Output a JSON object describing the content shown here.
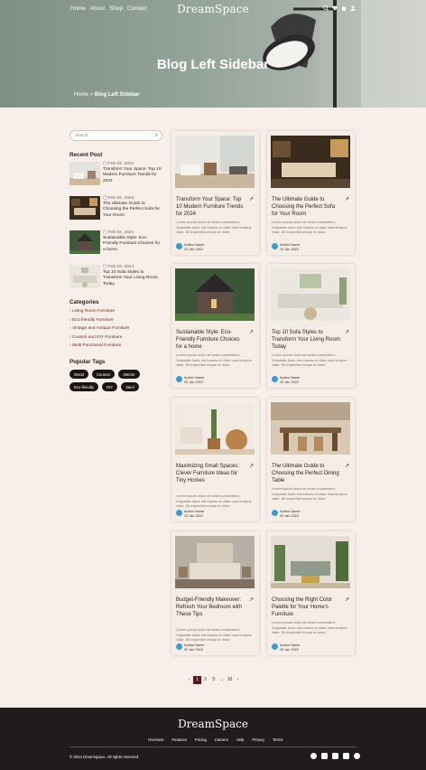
{
  "header": {
    "nav": [
      "Home",
      "About",
      "Shop",
      "Contact"
    ],
    "logo": "DreamSpace",
    "title": "Blog Left Sidebar",
    "crumb_home": "Home",
    "crumb_sep": ">",
    "crumb_current": "Blog Left Sidebar",
    "icons": [
      "search-icon",
      "heart-icon",
      "bag-icon",
      "user-icon"
    ]
  },
  "sidebar": {
    "search_placeholder": "Search",
    "recent_heading": "Recent Post",
    "recent": [
      {
        "date": "Feb 02, 2024",
        "title": "Transform Your Space: Top 10 Modern Furniture Trends for 2024"
      },
      {
        "date": "Feb 02, 2024",
        "title": "The Ultimate Guide to Choosing the Perfect Sofa for Your Room"
      },
      {
        "date": "Feb 02, 2024",
        "title": "Sustainable Style: Eco-Friendly Furniture Choices for a home"
      },
      {
        "date": "Feb 02, 2024",
        "title": "Top 10 Sofa Styles to Transform Your Living Room Today"
      }
    ],
    "categories_heading": "Categories",
    "categories": [
      "Living Room Furniture",
      "Eco-friendly Furniture",
      "Vintage and Antique Furniture",
      "Custom and DIY Furniture",
      "Multi-Functional Furniture"
    ],
    "tags_heading": "Popular Tags",
    "tags": [
      "Wood",
      "Ceramic",
      "Interior",
      "Eco-friendly",
      "DIY",
      "Steel"
    ]
  },
  "excerpt": "Lorem ipsum dolor sit amet consectetur. Vulputate dolor est mauris et vitae uma tempus vitae. Sit imperdiet neque in dolor.",
  "author_name": "Author Name",
  "author_date": "20 Jan 2022",
  "posts": [
    {
      "title": "Transform Your Space: Top 10 Modern Furniture Trends for 2024"
    },
    {
      "title": "The Ultimate Guide to Choosing the Perfect Sofa for Your Room"
    },
    {
      "title": "Sustainable Style: Eco-Friendly Furniture Choices for a home"
    },
    {
      "title": "Top 10 Sofa Styles to Transform Your Living Room Today"
    },
    {
      "title": "Maximizing Small Spaces: Clever Furniture Ideas for Tiny Homes"
    },
    {
      "title": "The Ultimate Guide to Choosing the Perfect Dining Table"
    },
    {
      "title": "Budget-Friendly Makeover: Refresh Your Bedroom with These Tips"
    },
    {
      "title": "Choosing the Right Color Palette for Your Home's Furniture"
    }
  ],
  "pagination": {
    "prev": "‹",
    "pages": [
      "1",
      "2",
      "3"
    ],
    "ellipsis": "...",
    "last": "10",
    "next": "›"
  },
  "footer": {
    "logo": "DreamSpace",
    "links": [
      "Overview",
      "Features",
      "Pricing",
      "Careers",
      "Help",
      "Privacy",
      "Terms"
    ],
    "copyright": "© 2024 Dreamspace. All rights reserved.",
    "social": [
      "facebook-icon",
      "youtube-icon",
      "linkedin-icon",
      "tiktok-icon",
      "instagram-icon"
    ]
  },
  "colors": {
    "accent": "#5a1717",
    "background": "#f8efea",
    "footer": "#1f1c1b"
  }
}
